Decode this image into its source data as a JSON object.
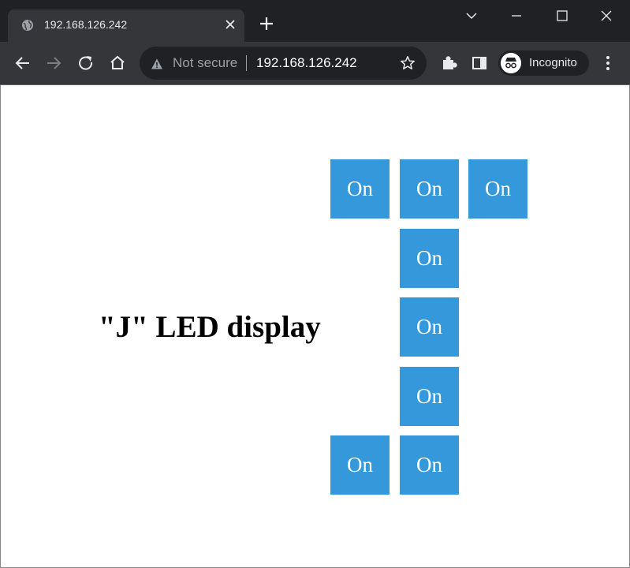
{
  "browser": {
    "tab_title": "192.168.126.242",
    "omnibox": {
      "security_label": "Not secure",
      "url": "192.168.126.242"
    },
    "profile_label": "Incognito",
    "icons": [
      "globe-icon",
      "close-icon",
      "plus-icon",
      "chevron-down-icon",
      "minimize-icon",
      "maximize-icon",
      "close-window-icon",
      "back-arrow-icon",
      "forward-arrow-icon",
      "reload-icon",
      "home-icon",
      "warning-icon",
      "star-icon",
      "puzzle-icon",
      "side-panel-icon",
      "incognito-icon",
      "kebab-menu-icon"
    ]
  },
  "page": {
    "title": "\"J\" LED display",
    "led_color": "#3498db",
    "leds": [
      {
        "id": "led-r1-c1",
        "label": "On"
      },
      {
        "id": "led-r1-c2",
        "label": "On"
      },
      {
        "id": "led-r1-c3",
        "label": "On"
      },
      {
        "id": "led-r2-c2",
        "label": "On"
      },
      {
        "id": "led-r3-c2",
        "label": "On"
      },
      {
        "id": "led-r4-c2",
        "label": "On"
      },
      {
        "id": "led-r5-c1",
        "label": "On"
      },
      {
        "id": "led-r5-c2",
        "label": "On"
      }
    ]
  }
}
